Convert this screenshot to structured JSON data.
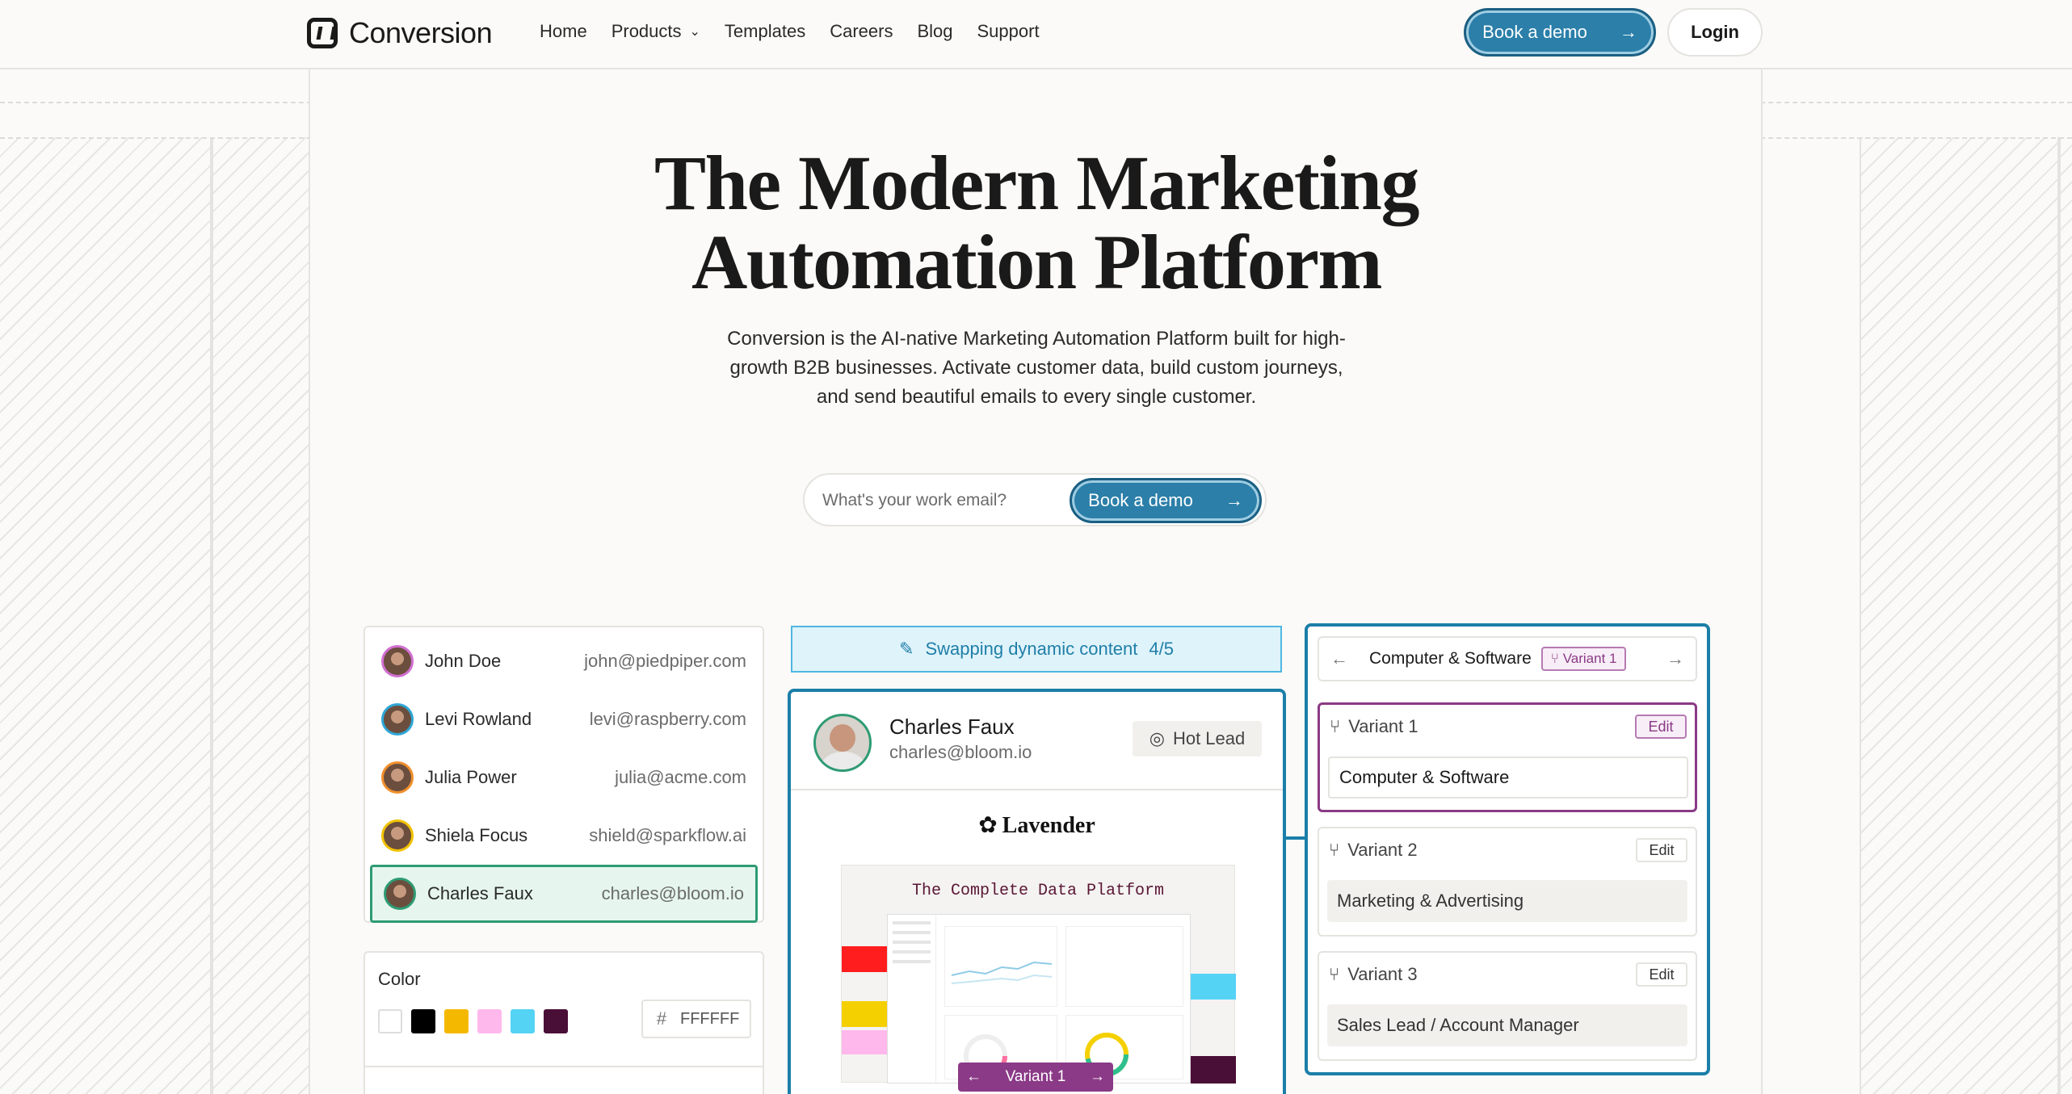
{
  "header": {
    "brand": "Conversion",
    "nav": [
      {
        "label": "Home"
      },
      {
        "label": "Products"
      },
      {
        "label": "Templates"
      },
      {
        "label": "Careers"
      },
      {
        "label": "Blog"
      },
      {
        "label": "Support"
      }
    ],
    "book_demo": "Book a demo",
    "login": "Login"
  },
  "hero": {
    "title_line1": "The Modern Marketing",
    "title_line2": "Automation Platform",
    "subtitle": "Conversion is the AI-native Marketing Automation Platform built for high-growth B2B businesses. Activate customer data, build custom journeys, and send beautiful emails to every single customer.",
    "email_placeholder": "What's your work email?",
    "cta": "Book a demo"
  },
  "contacts": [
    {
      "name": "John Doe",
      "email": "john@piedpiper.com",
      "ring": "#d06fd0"
    },
    {
      "name": "Levi Rowland",
      "email": "levi@raspberry.com",
      "ring": "#2fa6d6"
    },
    {
      "name": "Julia Power",
      "email": "julia@acme.com",
      "ring": "#f0902c"
    },
    {
      "name": "Shiela Focus",
      "email": "shield@sparkflow.ai",
      "ring": "#f2c200"
    },
    {
      "name": "Charles Faux",
      "email": "charles@bloom.io",
      "ring": "#2e9b74"
    }
  ],
  "color_picker": {
    "label": "Color",
    "swatches": [
      "#ffffff",
      "#000000",
      "#f5b800",
      "#ffb8ec",
      "#55d3f5",
      "#4a0f36"
    ],
    "hex_prefix": "#",
    "hex_value": "FFFFFF"
  },
  "swap_banner": {
    "text": "Swapping dynamic content",
    "count": "4/5"
  },
  "email_card": {
    "name": "Charles Faux",
    "email": "charles@bloom.io",
    "tag": "Hot Lead",
    "brand": "Lavender",
    "preview_title": "The Complete Data Platform",
    "variant_pill": "Variant 1"
  },
  "variants_panel": {
    "title": "Computer & Software",
    "badge": "Variant 1",
    "variants": [
      {
        "label": "Variant 1",
        "edit": "Edit",
        "value": "Computer & Software"
      },
      {
        "label": "Variant 2",
        "edit": "Edit",
        "value": "Marketing & Advertising"
      },
      {
        "label": "Variant 3",
        "edit": "Edit",
        "value": "Sales Lead / Account Manager"
      }
    ]
  },
  "colors": {
    "accent": "#2b7fa9",
    "accent_dark": "#1b7fa8",
    "variant_purple": "#8a3a86",
    "selected_green": "#2e9b74"
  }
}
